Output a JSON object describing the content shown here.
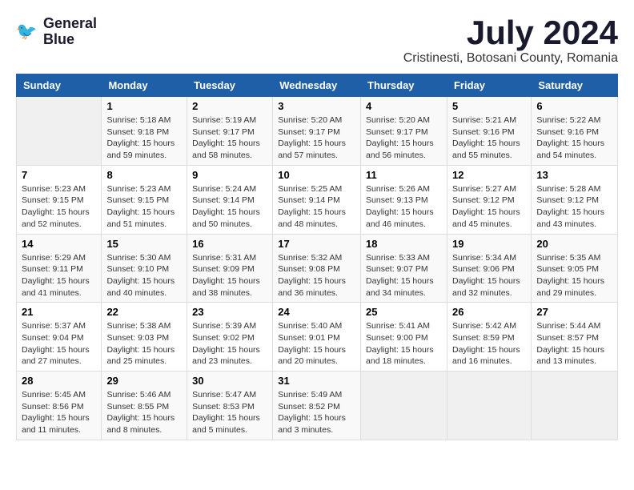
{
  "logo": {
    "line1": "General",
    "line2": "Blue"
  },
  "title": "July 2024",
  "location": "Cristinesti, Botosani County, Romania",
  "days_header": [
    "Sunday",
    "Monday",
    "Tuesday",
    "Wednesday",
    "Thursday",
    "Friday",
    "Saturday"
  ],
  "weeks": [
    [
      {
        "day": "",
        "info": ""
      },
      {
        "day": "1",
        "info": "Sunrise: 5:18 AM\nSunset: 9:18 PM\nDaylight: 15 hours\nand 59 minutes."
      },
      {
        "day": "2",
        "info": "Sunrise: 5:19 AM\nSunset: 9:17 PM\nDaylight: 15 hours\nand 58 minutes."
      },
      {
        "day": "3",
        "info": "Sunrise: 5:20 AM\nSunset: 9:17 PM\nDaylight: 15 hours\nand 57 minutes."
      },
      {
        "day": "4",
        "info": "Sunrise: 5:20 AM\nSunset: 9:17 PM\nDaylight: 15 hours\nand 56 minutes."
      },
      {
        "day": "5",
        "info": "Sunrise: 5:21 AM\nSunset: 9:16 PM\nDaylight: 15 hours\nand 55 minutes."
      },
      {
        "day": "6",
        "info": "Sunrise: 5:22 AM\nSunset: 9:16 PM\nDaylight: 15 hours\nand 54 minutes."
      }
    ],
    [
      {
        "day": "7",
        "info": "Sunrise: 5:23 AM\nSunset: 9:15 PM\nDaylight: 15 hours\nand 52 minutes."
      },
      {
        "day": "8",
        "info": "Sunrise: 5:23 AM\nSunset: 9:15 PM\nDaylight: 15 hours\nand 51 minutes."
      },
      {
        "day": "9",
        "info": "Sunrise: 5:24 AM\nSunset: 9:14 PM\nDaylight: 15 hours\nand 50 minutes."
      },
      {
        "day": "10",
        "info": "Sunrise: 5:25 AM\nSunset: 9:14 PM\nDaylight: 15 hours\nand 48 minutes."
      },
      {
        "day": "11",
        "info": "Sunrise: 5:26 AM\nSunset: 9:13 PM\nDaylight: 15 hours\nand 46 minutes."
      },
      {
        "day": "12",
        "info": "Sunrise: 5:27 AM\nSunset: 9:12 PM\nDaylight: 15 hours\nand 45 minutes."
      },
      {
        "day": "13",
        "info": "Sunrise: 5:28 AM\nSunset: 9:12 PM\nDaylight: 15 hours\nand 43 minutes."
      }
    ],
    [
      {
        "day": "14",
        "info": "Sunrise: 5:29 AM\nSunset: 9:11 PM\nDaylight: 15 hours\nand 41 minutes."
      },
      {
        "day": "15",
        "info": "Sunrise: 5:30 AM\nSunset: 9:10 PM\nDaylight: 15 hours\nand 40 minutes."
      },
      {
        "day": "16",
        "info": "Sunrise: 5:31 AM\nSunset: 9:09 PM\nDaylight: 15 hours\nand 38 minutes."
      },
      {
        "day": "17",
        "info": "Sunrise: 5:32 AM\nSunset: 9:08 PM\nDaylight: 15 hours\nand 36 minutes."
      },
      {
        "day": "18",
        "info": "Sunrise: 5:33 AM\nSunset: 9:07 PM\nDaylight: 15 hours\nand 34 minutes."
      },
      {
        "day": "19",
        "info": "Sunrise: 5:34 AM\nSunset: 9:06 PM\nDaylight: 15 hours\nand 32 minutes."
      },
      {
        "day": "20",
        "info": "Sunrise: 5:35 AM\nSunset: 9:05 PM\nDaylight: 15 hours\nand 29 minutes."
      }
    ],
    [
      {
        "day": "21",
        "info": "Sunrise: 5:37 AM\nSunset: 9:04 PM\nDaylight: 15 hours\nand 27 minutes."
      },
      {
        "day": "22",
        "info": "Sunrise: 5:38 AM\nSunset: 9:03 PM\nDaylight: 15 hours\nand 25 minutes."
      },
      {
        "day": "23",
        "info": "Sunrise: 5:39 AM\nSunset: 9:02 PM\nDaylight: 15 hours\nand 23 minutes."
      },
      {
        "day": "24",
        "info": "Sunrise: 5:40 AM\nSunset: 9:01 PM\nDaylight: 15 hours\nand 20 minutes."
      },
      {
        "day": "25",
        "info": "Sunrise: 5:41 AM\nSunset: 9:00 PM\nDaylight: 15 hours\nand 18 minutes."
      },
      {
        "day": "26",
        "info": "Sunrise: 5:42 AM\nSunset: 8:59 PM\nDaylight: 15 hours\nand 16 minutes."
      },
      {
        "day": "27",
        "info": "Sunrise: 5:44 AM\nSunset: 8:57 PM\nDaylight: 15 hours\nand 13 minutes."
      }
    ],
    [
      {
        "day": "28",
        "info": "Sunrise: 5:45 AM\nSunset: 8:56 PM\nDaylight: 15 hours\nand 11 minutes."
      },
      {
        "day": "29",
        "info": "Sunrise: 5:46 AM\nSunset: 8:55 PM\nDaylight: 15 hours\nand 8 minutes."
      },
      {
        "day": "30",
        "info": "Sunrise: 5:47 AM\nSunset: 8:53 PM\nDaylight: 15 hours\nand 5 minutes."
      },
      {
        "day": "31",
        "info": "Sunrise: 5:49 AM\nSunset: 8:52 PM\nDaylight: 15 hours\nand 3 minutes."
      },
      {
        "day": "",
        "info": ""
      },
      {
        "day": "",
        "info": ""
      },
      {
        "day": "",
        "info": ""
      }
    ]
  ]
}
